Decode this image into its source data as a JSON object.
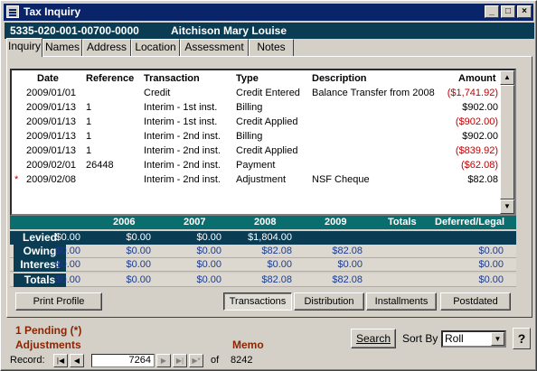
{
  "window": {
    "title": "Tax Inquiry"
  },
  "header": {
    "account": "5335-020-001-00700-0000",
    "owner": "Aitchison Mary Louise"
  },
  "tabs": [
    "Inquiry",
    "Names",
    "Address",
    "Location",
    "Assessment",
    "Notes"
  ],
  "grid": {
    "headers": {
      "date": "Date",
      "reference": "Reference",
      "transaction": "Transaction",
      "type": "Type",
      "description": "Description",
      "amount": "Amount"
    },
    "rows": [
      {
        "marker": "",
        "date": "2009/01/01",
        "reference": "",
        "transaction": "Credit",
        "type": "Credit Entered",
        "description": "Balance Transfer from 2008",
        "amount": "($1,741.92)",
        "negative": true
      },
      {
        "marker": "",
        "date": "2009/01/13",
        "reference": "1",
        "transaction": "Interim - 1st inst.",
        "type": "Billing",
        "description": "",
        "amount": "$902.00",
        "negative": false
      },
      {
        "marker": "",
        "date": "2009/01/13",
        "reference": "1",
        "transaction": "Interim - 1st inst.",
        "type": "Credit Applied",
        "description": "",
        "amount": "($902.00)",
        "negative": true
      },
      {
        "marker": "",
        "date": "2009/01/13",
        "reference": "1",
        "transaction": "Interim - 2nd inst.",
        "type": "Billing",
        "description": "",
        "amount": "$902.00",
        "negative": false
      },
      {
        "marker": "",
        "date": "2009/01/13",
        "reference": "1",
        "transaction": "Interim - 2nd inst.",
        "type": "Credit Applied",
        "description": "",
        "amount": "($839.92)",
        "negative": true
      },
      {
        "marker": "",
        "date": "2009/02/01",
        "reference": "26448",
        "transaction": "Interim - 2nd inst.",
        "type": "Payment",
        "description": "",
        "amount": "($62.08)",
        "negative": true
      },
      {
        "marker": "*",
        "date": "2009/02/08",
        "reference": "",
        "transaction": "Interim - 2nd inst.",
        "type": "Adjustment",
        "description": "NSF Cheque",
        "amount": "$82.08",
        "negative": false
      }
    ]
  },
  "summary": {
    "columns": [
      "2006",
      "2007",
      "2008",
      "2009",
      "Totals",
      "Deferred/Legal"
    ],
    "rows": [
      {
        "label": "Levied",
        "values": [
          "$0.00",
          "$0.00",
          "$0.00",
          "$1,804.00",
          "",
          ""
        ]
      },
      {
        "label": "Owing",
        "values": [
          "$0.00",
          "$0.00",
          "$0.00",
          "$82.08",
          "$82.08",
          "$0.00"
        ]
      },
      {
        "label": "Interest",
        "values": [
          "$0.00",
          "$0.00",
          "$0.00",
          "$0.00",
          "$0.00",
          "$0.00"
        ]
      },
      {
        "label": "Totals",
        "values": [
          "$0.00",
          "$0.00",
          "$0.00",
          "$82.08",
          "$82.08",
          "$0.00"
        ]
      }
    ]
  },
  "buttons": {
    "print_profile": "Print Profile",
    "transactions": "Transactions",
    "distribution": "Distribution",
    "installments": "Installments",
    "postdated": "Postdated",
    "search": "Search",
    "help": "?"
  },
  "status": {
    "pending": "1 Pending  (*)",
    "adjustments": "Adjustments",
    "memo": "Memo"
  },
  "sort": {
    "label": "Sort By",
    "value": "Roll"
  },
  "record": {
    "label": "Record:",
    "current": "7264",
    "of_label": "of",
    "total": "8242"
  }
}
